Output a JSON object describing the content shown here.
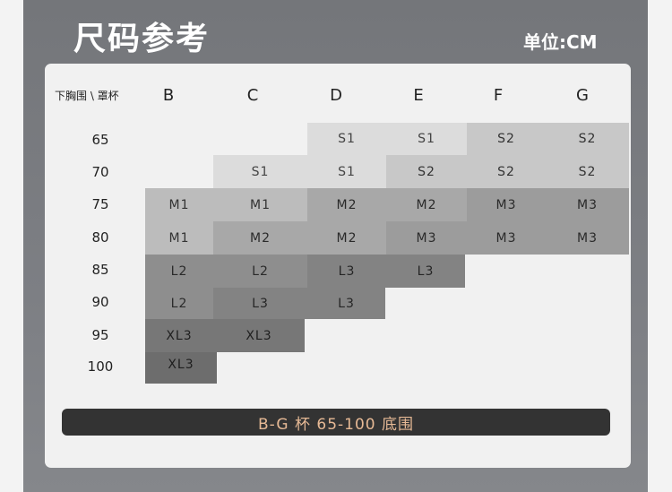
{
  "header": {
    "title": "尺码参考",
    "unit": "单位:CM"
  },
  "table": {
    "corner_label": "下胸围 \\ 罩杯",
    "cups": [
      "B",
      "C",
      "D",
      "E",
      "F",
      "G"
    ],
    "bands": [
      "65",
      "70",
      "75",
      "80",
      "85",
      "90",
      "95",
      "100"
    ],
    "rows": [
      [
        "",
        "",
        "S1",
        "S1",
        "S2",
        "S2"
      ],
      [
        "",
        "S1",
        "S1",
        "S2",
        "S2",
        "S2"
      ],
      [
        "M1",
        "M1",
        "M2",
        "M2",
        "M3",
        "M3"
      ],
      [
        "M1",
        "M2",
        "M2",
        "M3",
        "M3",
        "M3"
      ],
      [
        "L2",
        "L2",
        "L3",
        "L3",
        "",
        ""
      ],
      [
        "L2",
        "L3",
        "L3",
        "",
        "",
        ""
      ],
      [
        "XL3",
        "XL3",
        "",
        "",
        "",
        ""
      ],
      [
        "XL3",
        "",
        "",
        "",
        "",
        ""
      ]
    ]
  },
  "footer": {
    "banner": "B-G 杯  65-100 底围"
  }
}
